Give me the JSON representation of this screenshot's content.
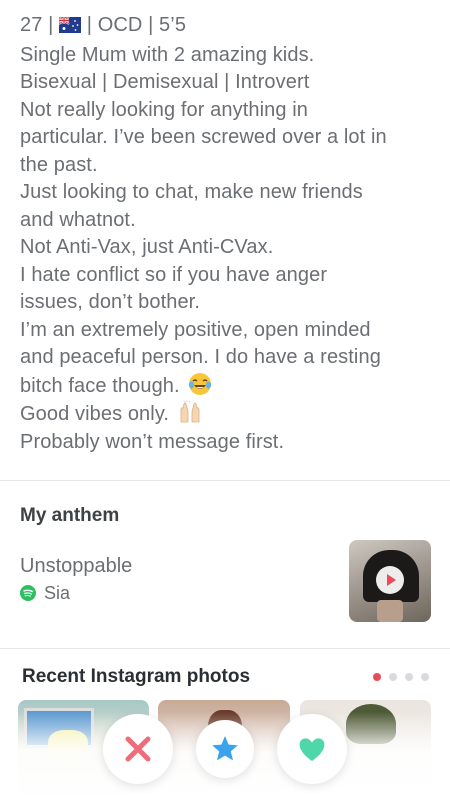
{
  "profile": {
    "bio_first": "27 |",
    "bio_first_rest": "| OCD | 5’5",
    "flag_icon": "australia-flag-icon",
    "bio_lines": [
      "Single Mum with 2 amazing kids.",
      "Bisexual | Demisexual | Introvert",
      "Not really looking for anything in",
      "particular. I’ve been screwed over a lot in",
      "the past.",
      "Just looking to chat, make new friends",
      "and whatnot.",
      "Not Anti-Vax, just Anti-CVax.",
      "I hate conflict so if you have anger",
      "issues, don’t bother.",
      "I’m an extremely positive, open minded",
      "and peaceful person. I do have a resting",
      "bitch face though.",
      "Good vibes only.",
      "Probably won’t message first."
    ],
    "emoji_1": "face-with-tears-of-joy-icon",
    "emoji_2": "raising-hands-icon"
  },
  "anthem": {
    "title": "My anthem",
    "song": "Unstoppable",
    "artist": "Sia",
    "artist_icon": "spotify-icon",
    "play_icon": "play-icon"
  },
  "instagram": {
    "title": "Recent Instagram photos",
    "page_count": 4,
    "active_page": 1
  },
  "actions": {
    "nope_icon": "close-icon",
    "superlike_icon": "star-icon",
    "like_icon": "heart-icon"
  },
  "colors": {
    "accent_red": "#ec4a5b",
    "nope": "#f06c7b",
    "superlike": "#3aa3ec",
    "like": "#4fd6a9",
    "spotify": "#2fbf63"
  }
}
